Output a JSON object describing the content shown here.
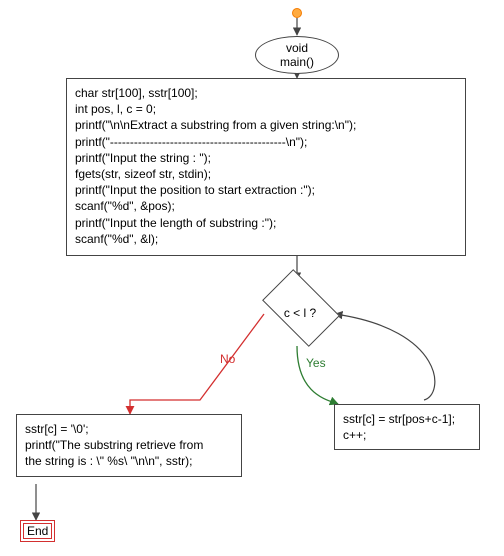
{
  "start_node": "void main()",
  "init_block": "char str[100], sstr[100];\nint pos, l, c = 0;\nprintf(\"\\n\\nExtract a substring from a given string:\\n\");\nprintf(\"--------------------------------------------\\n\");\nprintf(\"Input the string : \");\nfgets(str, sizeof str, stdin);\nprintf(\"Input the position to start extraction :\");\nscanf(\"%d\", &pos);\nprintf(\"Input the length of substring :\");\nscanf(\"%d\", &l);",
  "condition": "c < l ?",
  "yes_label": "Yes",
  "no_label": "No",
  "loop_body": "sstr[c] = str[pos+c-1];\nc++;",
  "after_loop": "sstr[c] = '\\0';\nprintf(\"The substring retrieve from\nthe string is : \\\" %s\\ \"\\n\\n\", sstr);",
  "end_label": "End",
  "chart_data": {
    "type": "flowchart",
    "nodes": [
      {
        "id": "start",
        "kind": "start",
        "label": ""
      },
      {
        "id": "main",
        "kind": "terminator",
        "label": "void main()"
      },
      {
        "id": "init",
        "kind": "process",
        "label": "char str[100], sstr[100]; int pos, l, c = 0; printf(...); fgets(str, sizeof str, stdin); printf(\"Input the position to start extraction :\"); scanf(\"%d\", &pos); printf(\"Input the length of substring :\"); scanf(\"%d\", &l);"
      },
      {
        "id": "cond",
        "kind": "decision",
        "label": "c < l ?"
      },
      {
        "id": "body",
        "kind": "process",
        "label": "sstr[c] = str[pos+c-1]; c++;"
      },
      {
        "id": "after",
        "kind": "process",
        "label": "sstr[c] = '\\0'; printf(\"The substring retrieve from the string is : \\\" %s\\\" \\n\\n\", sstr);"
      },
      {
        "id": "end",
        "kind": "end",
        "label": "End"
      }
    ],
    "edges": [
      {
        "from": "start",
        "to": "main"
      },
      {
        "from": "main",
        "to": "init"
      },
      {
        "from": "init",
        "to": "cond"
      },
      {
        "from": "cond",
        "to": "body",
        "label": "Yes"
      },
      {
        "from": "body",
        "to": "cond"
      },
      {
        "from": "cond",
        "to": "after",
        "label": "No"
      },
      {
        "from": "after",
        "to": "end"
      }
    ]
  }
}
